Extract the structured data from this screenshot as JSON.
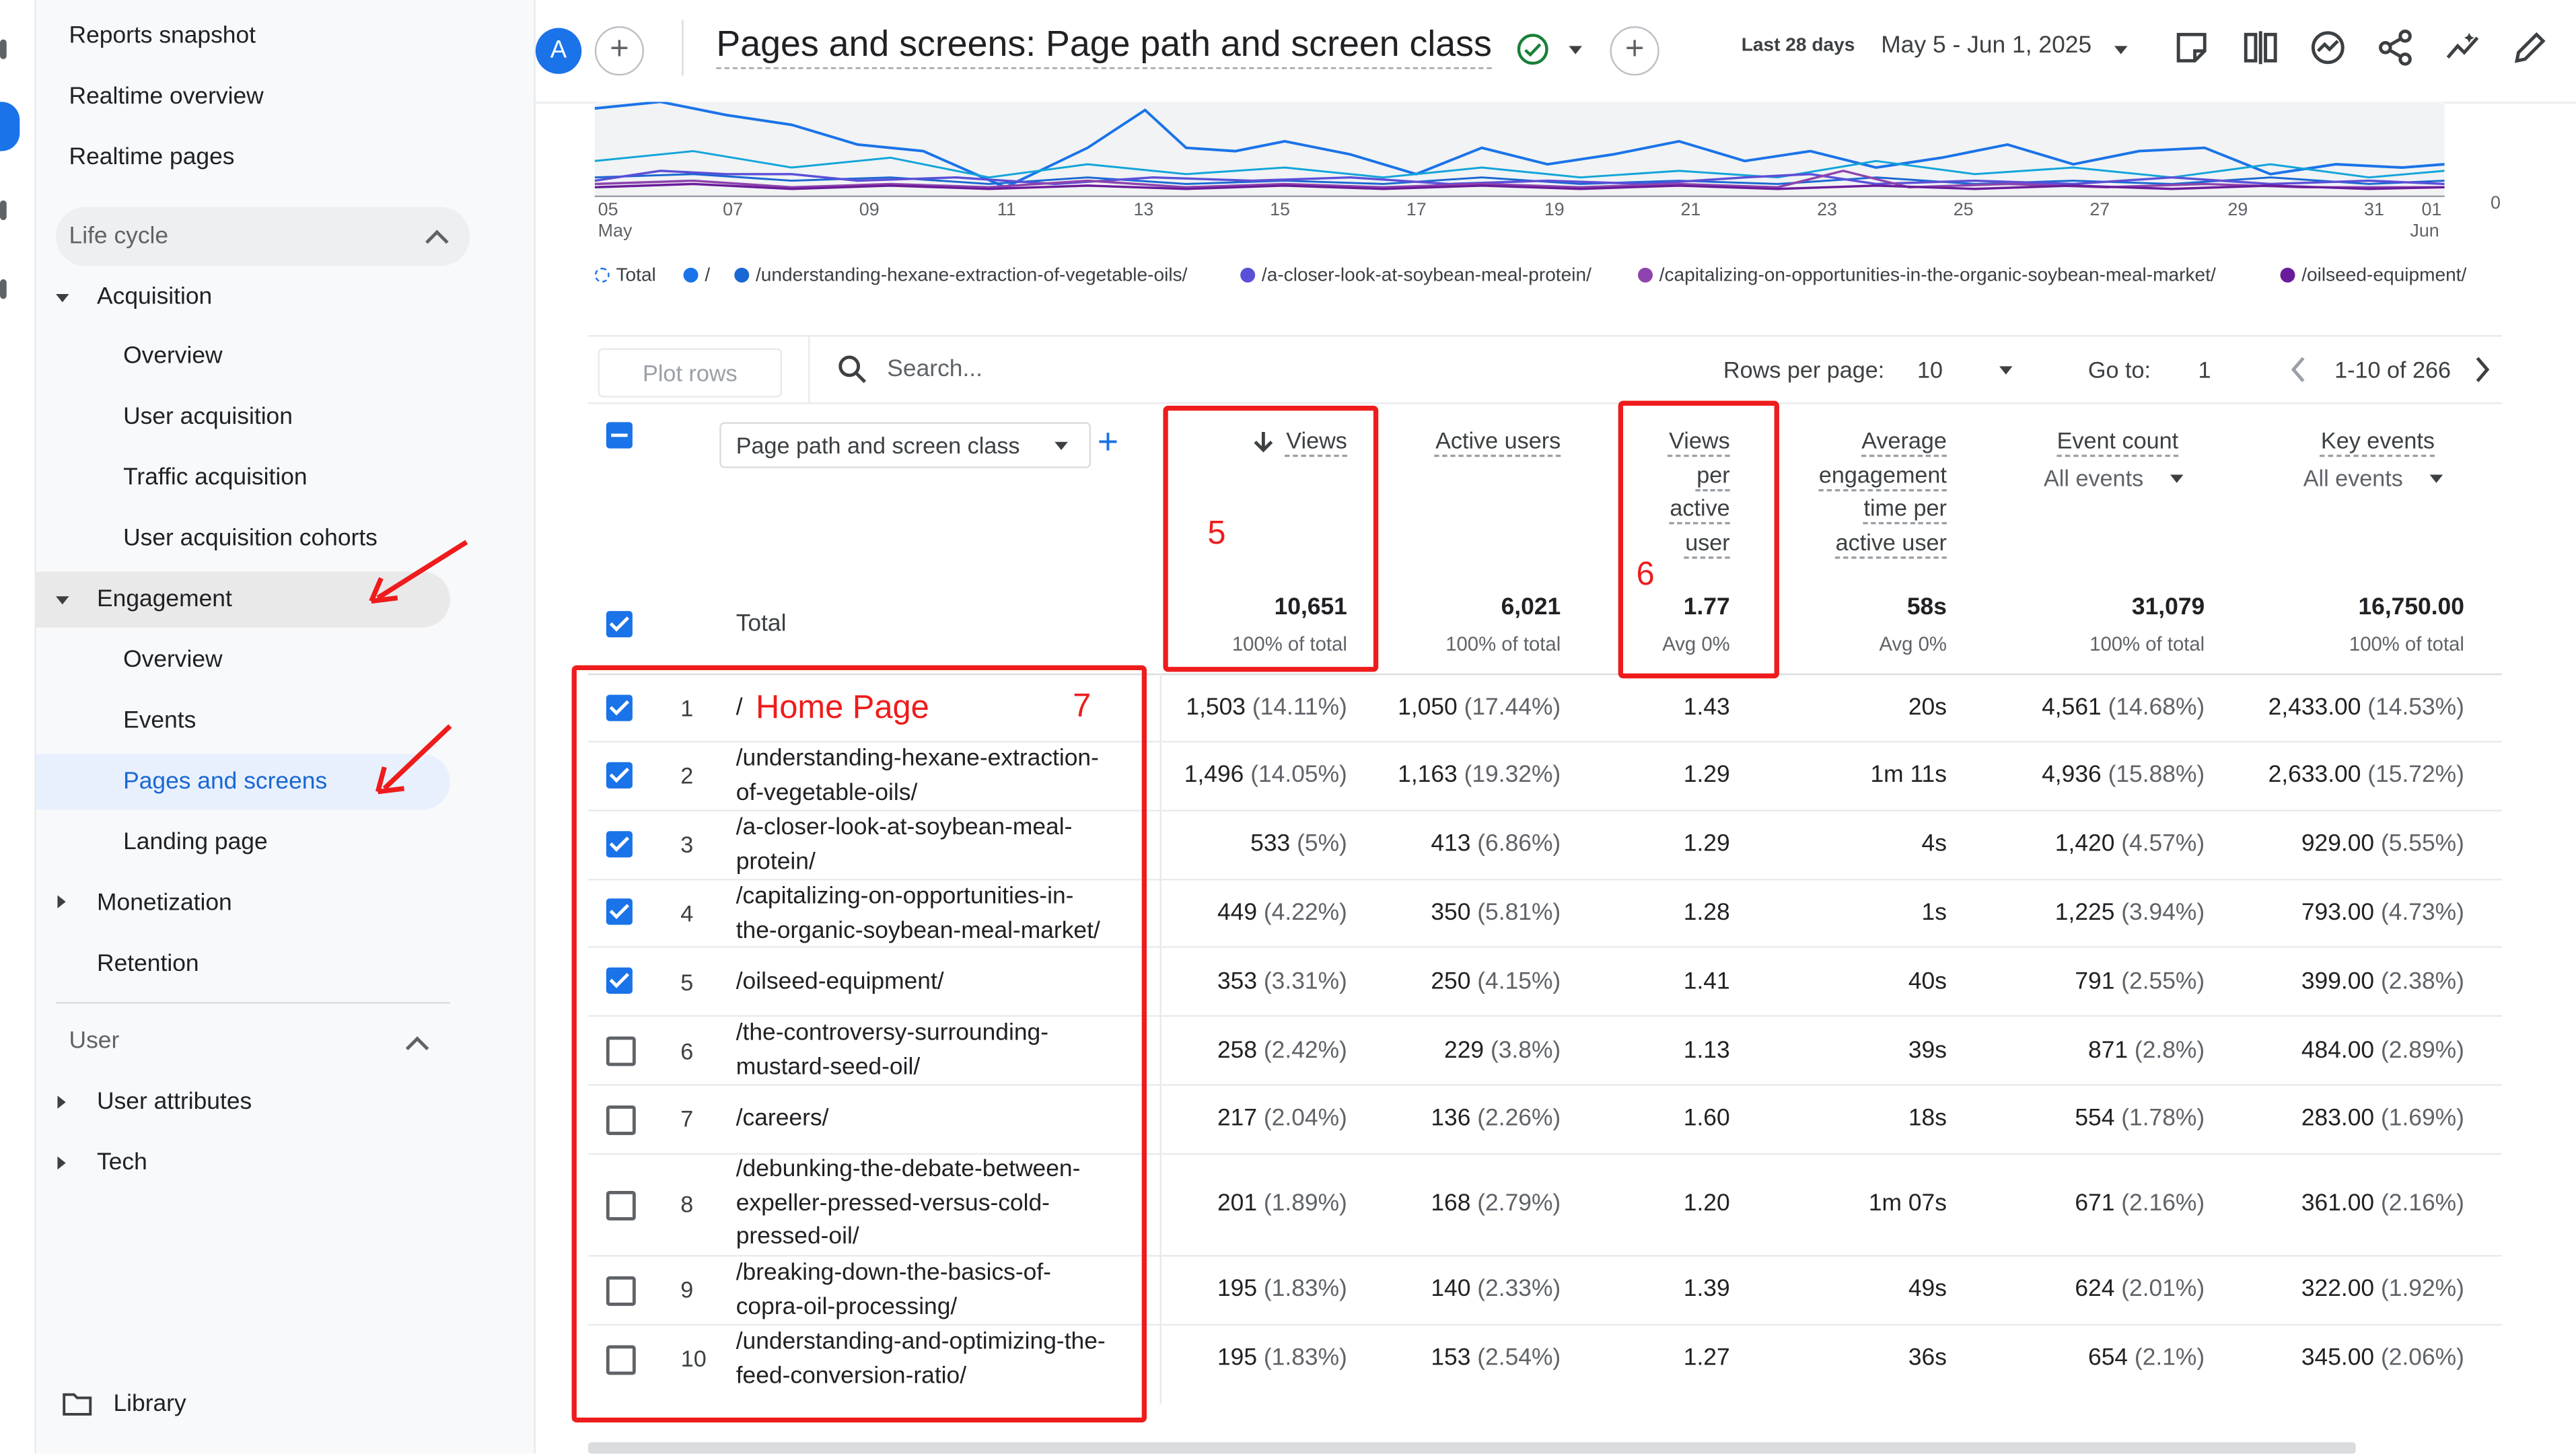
{
  "sidebar": {
    "top_items": [
      "Reports snapshot",
      "Realtime overview",
      "Realtime pages"
    ],
    "lifecycle_label": "Life cycle",
    "acquisition": {
      "label": "Acquisition",
      "items": [
        "Overview",
        "User acquisition",
        "Traffic acquisition",
        "User acquisition cohorts"
      ]
    },
    "engagement": {
      "label": "Engagement",
      "items": [
        "Overview",
        "Events",
        "Pages and screens",
        "Landing page"
      ]
    },
    "monetization_label": "Monetization",
    "retention_label": "Retention",
    "user_label": "User",
    "user_attributes_label": "User attributes",
    "tech_label": "Tech",
    "library_label": "Library"
  },
  "header": {
    "avatar_letter": "A",
    "title": "Pages and screens: Page path and screen class",
    "date_preset": "Last 28 days",
    "date_range": "May 5 - Jun 1, 2025",
    "icons": [
      "report-icon",
      "compare-icon",
      "insights-icon",
      "share-icon",
      "trend-icon",
      "edit-icon"
    ]
  },
  "chart": {
    "x_labels": [
      "05",
      "07",
      "09",
      "11",
      "13",
      "15",
      "17",
      "19",
      "21",
      "23",
      "25",
      "27",
      "29",
      "31",
      "01"
    ],
    "x_sub_first": "May",
    "x_sub_last": "Jun",
    "y_zero": "0",
    "legend": [
      "Total",
      "/",
      "/understanding-hexane-extraction-of-vegetable-oils/",
      "/a-closer-look-at-soybean-meal-protein/",
      "/capitalizing-on-opportunities-in-the-organic-soybean-meal-market/",
      "/oilseed-equipment/"
    ],
    "colors": {
      "total": "#1a73e8",
      "s1": "#12a4d9",
      "s2": "#1967d2",
      "s3": "#5b4fd8",
      "s4": "#8e44ad",
      "s5": "#6a1b9a"
    }
  },
  "toolbar": {
    "plot_rows": "Plot rows",
    "search_placeholder": "Search...",
    "rows_per_page_label": "Rows per page:",
    "rows_per_page_value": "10",
    "goto_label": "Go to:",
    "goto_value": "1",
    "pagination": "1-10 of 266"
  },
  "table": {
    "dimension_select": "Page path and screen class",
    "columns": {
      "views": [
        "Views"
      ],
      "active_users": [
        "Active users"
      ],
      "views_per_user": [
        "Views",
        "per",
        "active",
        "user"
      ],
      "avg_engagement": [
        "Average",
        "engagement",
        "time per",
        "active user"
      ],
      "event_count": [
        "Event count"
      ],
      "event_count_sub": "All events",
      "key_events": [
        "Key events"
      ],
      "key_events_sub": "All events"
    },
    "total": {
      "label": "Total",
      "views": "10,651",
      "views_sub": "100% of total",
      "active_users": "6,021",
      "active_users_sub": "100% of total",
      "vpu": "1.77",
      "vpu_sub": "Avg 0%",
      "aet": "58s",
      "aet_sub": "Avg 0%",
      "events": "31,079",
      "events_sub": "100% of total",
      "key": "16,750.00",
      "key_sub": "100% of total"
    },
    "rows": [
      {
        "n": "1",
        "path": [
          "/"
        ],
        "views": "1,503",
        "views_p": "(14.11%)",
        "users": "1,050",
        "users_p": "(17.44%)",
        "vpu": "1.43",
        "aet": "20s",
        "events": "4,561",
        "events_p": "(14.68%)",
        "key": "2,433.00",
        "key_p": "(14.53%)",
        "checked": true
      },
      {
        "n": "2",
        "path": [
          "/understanding-hexane-extraction-",
          "of-vegetable-oils/"
        ],
        "views": "1,496",
        "views_p": "(14.05%)",
        "users": "1,163",
        "users_p": "(19.32%)",
        "vpu": "1.29",
        "aet": "1m 11s",
        "events": "4,936",
        "events_p": "(15.88%)",
        "key": "2,633.00",
        "key_p": "(15.72%)",
        "checked": true
      },
      {
        "n": "3",
        "path": [
          "/a-closer-look-at-soybean-meal-",
          "protein/"
        ],
        "views": "533",
        "views_p": "(5%)",
        "users": "413",
        "users_p": "(6.86%)",
        "vpu": "1.29",
        "aet": "4s",
        "events": "1,420",
        "events_p": "(4.57%)",
        "key": "929.00",
        "key_p": "(5.55%)",
        "checked": true
      },
      {
        "n": "4",
        "path": [
          "/capitalizing-on-opportunities-in-",
          "the-organic-soybean-meal-market/"
        ],
        "views": "449",
        "views_p": "(4.22%)",
        "users": "350",
        "users_p": "(5.81%)",
        "vpu": "1.28",
        "aet": "1s",
        "events": "1,225",
        "events_p": "(3.94%)",
        "key": "793.00",
        "key_p": "(4.73%)",
        "checked": true
      },
      {
        "n": "5",
        "path": [
          "/oilseed-equipment/"
        ],
        "views": "353",
        "views_p": "(3.31%)",
        "users": "250",
        "users_p": "(4.15%)",
        "vpu": "1.41",
        "aet": "40s",
        "events": "791",
        "events_p": "(2.55%)",
        "key": "399.00",
        "key_p": "(2.38%)",
        "checked": true
      },
      {
        "n": "6",
        "path": [
          "/the-controversy-surrounding-",
          "mustard-seed-oil/"
        ],
        "views": "258",
        "views_p": "(2.42%)",
        "users": "229",
        "users_p": "(3.8%)",
        "vpu": "1.13",
        "aet": "39s",
        "events": "871",
        "events_p": "(2.8%)",
        "key": "484.00",
        "key_p": "(2.89%)",
        "checked": false
      },
      {
        "n": "7",
        "path": [
          "/careers/"
        ],
        "views": "217",
        "views_p": "(2.04%)",
        "users": "136",
        "users_p": "(2.26%)",
        "vpu": "1.60",
        "aet": "18s",
        "events": "554",
        "events_p": "(1.78%)",
        "key": "283.00",
        "key_p": "(1.69%)",
        "checked": false
      },
      {
        "n": "8",
        "path": [
          "/debunking-the-debate-between-",
          "expeller-pressed-versus-cold-",
          "pressed-oil/"
        ],
        "views": "201",
        "views_p": "(1.89%)",
        "users": "168",
        "users_p": "(2.79%)",
        "vpu": "1.20",
        "aet": "1m 07s",
        "events": "671",
        "events_p": "(2.16%)",
        "key": "361.00",
        "key_p": "(2.16%)",
        "checked": false
      },
      {
        "n": "9",
        "path": [
          "/breaking-down-the-basics-of-",
          "copra-oil-processing/"
        ],
        "views": "195",
        "views_p": "(1.83%)",
        "users": "140",
        "users_p": "(2.33%)",
        "vpu": "1.39",
        "aet": "49s",
        "events": "624",
        "events_p": "(2.01%)",
        "key": "322.00",
        "key_p": "(1.92%)",
        "checked": false
      },
      {
        "n": "10",
        "path": [
          "/understanding-and-optimizing-the-",
          "feed-conversion-ratio/"
        ],
        "views": "195",
        "views_p": "(1.83%)",
        "users": "153",
        "users_p": "(2.54%)",
        "vpu": "1.27",
        "aet": "36s",
        "events": "654",
        "events_p": "(2.1%)",
        "key": "345.00",
        "key_p": "(2.06%)",
        "checked": false
      }
    ]
  },
  "annotations": {
    "label_5": "5",
    "label_6": "6",
    "label_7": "7",
    "home_page": "Home Page"
  }
}
